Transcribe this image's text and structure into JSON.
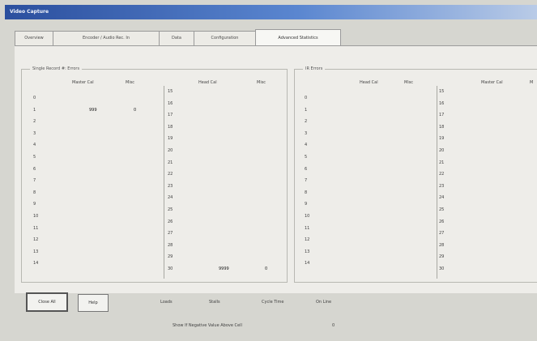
{
  "window": {
    "title": "Video Capture"
  },
  "tabs": [
    {
      "label": "Overview"
    },
    {
      "label": "Encoder / Audio Rec. In"
    },
    {
      "label": "Data"
    },
    {
      "label": "Configuration"
    },
    {
      "label": "Advanced Statistics"
    }
  ],
  "left_group": {
    "title": "Single Record #: Errors",
    "col_headers": [
      "Master Cal",
      "Misc",
      "Head Cal",
      "Misc"
    ],
    "rows_a": [
      "0",
      "1",
      "2",
      "3",
      "4",
      "5",
      "6",
      "7",
      "8",
      "9",
      "10",
      "11",
      "12",
      "13",
      "14"
    ],
    "rows_b": [
      "15",
      "16",
      "17",
      "18",
      "19",
      "20",
      "21",
      "22",
      "23",
      "24",
      "25",
      "26",
      "27",
      "28",
      "29",
      "30"
    ],
    "first_row_vals": [
      "999",
      "0"
    ],
    "last_row_vals": [
      "9999",
      "0"
    ]
  },
  "right_group": {
    "title": "IR Errors",
    "col_headers": [
      "Head Cal",
      "Misc",
      "Master Cal",
      "M"
    ],
    "rows_a": [
      "0",
      "1",
      "2",
      "3",
      "4",
      "5",
      "6",
      "7",
      "8",
      "9",
      "10",
      "11",
      "12",
      "13",
      "14"
    ],
    "rows_b": [
      "15",
      "16",
      "17",
      "18",
      "19",
      "20",
      "21",
      "22",
      "23",
      "24",
      "25",
      "26",
      "27",
      "28",
      "29",
      "30"
    ]
  },
  "buttons": {
    "close": "Close All",
    "help": "Help"
  },
  "status": {
    "items": [
      "Loads",
      "Stalls",
      "Cycle Time",
      "On Line"
    ],
    "bottom_label": "Show If Negative Value Above Cell",
    "bottom_value": "0"
  }
}
